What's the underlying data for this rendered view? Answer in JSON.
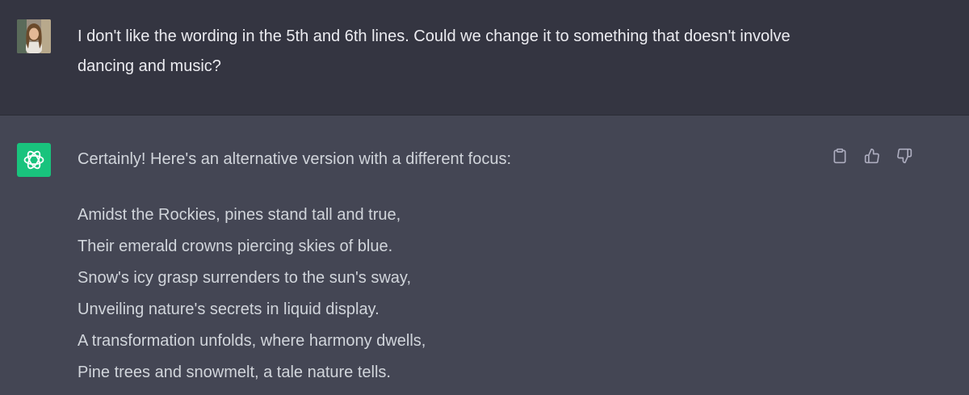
{
  "conversation": {
    "user_message": {
      "text": "I don't like the wording in the 5th and 6th lines. Could we change it to something that doesn't involve dancing and music?"
    },
    "assistant_message": {
      "intro": "Certainly! Here's an alternative version with a different focus:",
      "poem_lines": [
        "Amidst the Rockies, pines stand tall and true,",
        "Their emerald crowns piercing skies of blue.",
        "Snow's icy grasp surrenders to the sun's sway,",
        "Unveiling nature's secrets in liquid display.",
        "A transformation unfolds, where harmony dwells,",
        "Pine trees and snowmelt, a tale nature tells."
      ],
      "actions": [
        {
          "name": "copy-button",
          "icon": "clipboard-icon"
        },
        {
          "name": "thumbs-up-button",
          "icon": "thumbs-up-icon"
        },
        {
          "name": "thumbs-down-button",
          "icon": "thumbs-down-icon"
        }
      ]
    }
  },
  "colors": {
    "user_bg": "#343541",
    "assistant_bg": "#444654",
    "brand_green": "#19c37d",
    "text": "#d1d5db"
  }
}
